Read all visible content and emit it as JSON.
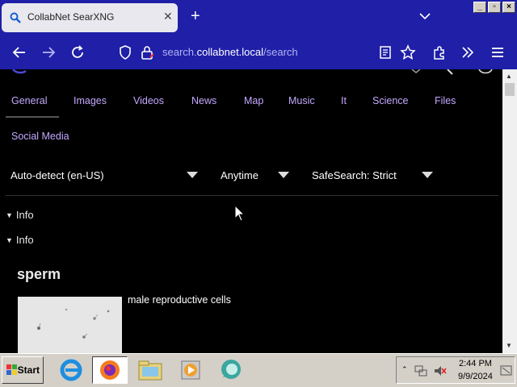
{
  "browser": {
    "tab_title": "CollabNet SearXNG",
    "url_prefix": "search.",
    "url_domain": "collabnet.local",
    "url_path": "/search"
  },
  "categories": [
    "General",
    "Images",
    "Videos",
    "News",
    "Map",
    "Music",
    "It",
    "Science",
    "Files",
    "Social Media"
  ],
  "filters": {
    "language": "Auto-detect (en-US)",
    "time": "Anytime",
    "safesearch": "SafeSearch: Strict"
  },
  "info_sections": [
    "Info",
    "Info"
  ],
  "answer": {
    "title": "sperm",
    "description": "male reproductive cells"
  },
  "taskbar": {
    "start_label": "Start",
    "time": "2:44 PM",
    "date": "9/9/2024"
  },
  "colors": {
    "chrome": "#1f1fa8",
    "link": "#c4a8ff",
    "background": "#000000"
  }
}
